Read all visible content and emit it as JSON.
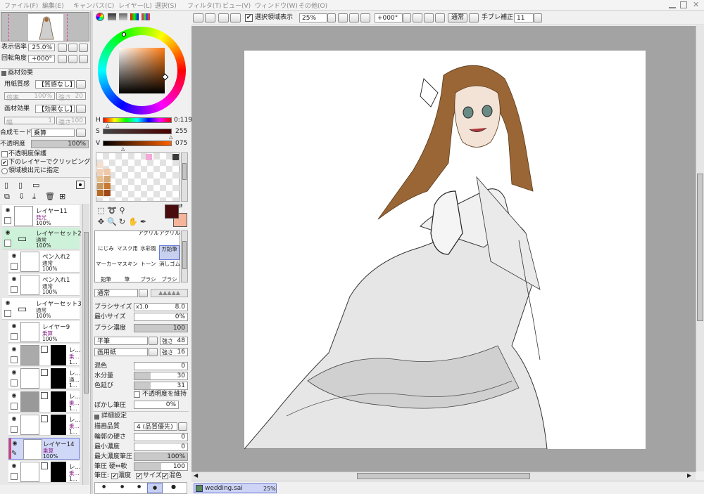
{
  "menu": [
    "ファイル(F)",
    "編集(E)",
    "キャンバス(C)",
    "レイヤー(L)",
    "選択(S)",
    "フィルタ(T)",
    "ビュー(V)",
    "ウィンドウ(W)",
    "その他(O)"
  ],
  "navigator": {
    "zoom_label": "表示倍率",
    "zoom_value": "25.0%",
    "rotate_label": "回転角度",
    "rotate_value": "+000°"
  },
  "texture": {
    "section": "画材効果",
    "paper_label": "用紙質感",
    "paper_value": "【質感なし】",
    "scale_label": "倍率",
    "scale_value": "100%",
    "strength_label": "強さ",
    "strength_value": "20",
    "effect_label": "画材効果",
    "effect_value": "【効果なし】",
    "width_label": "幅",
    "width_value": "1",
    "strength2_label": "強さ",
    "strength2_value": "100"
  },
  "blend": {
    "mode_label": "合成モード",
    "mode_value": "乗算",
    "opacity_label": "不透明度",
    "opacity_value": "100%",
    "opacity_fraction": 1.0,
    "protect": "不透明度保護",
    "clipping": "下のレイヤーでクリッピング",
    "selection_source": "領域検出元に指定"
  },
  "layers": [
    {
      "name": "レイヤー11",
      "mode": "発光",
      "opacity": "100%"
    },
    {
      "name": "レイヤーセット2",
      "mode": "通常",
      "opacity": "100%"
    },
    {
      "name": "ペン入れ2",
      "mode": "通常",
      "opacity": "100%"
    },
    {
      "name": "ペン入れ1",
      "mode": "通常",
      "opacity": "100%"
    },
    {
      "name": "レイヤーセット3",
      "mode": "通常",
      "opacity": "100%"
    },
    {
      "name": "レイヤー9",
      "mode": "乗算",
      "opacity": "100%"
    },
    {
      "name": "レ...",
      "mode": "乗...",
      "opacity": "1..."
    },
    {
      "name": "レ...",
      "mode": "通...",
      "opacity": "1..."
    },
    {
      "name": "レ...",
      "mode": "乗...",
      "opacity": "1..."
    },
    {
      "name": "レ...",
      "mode": "乗...",
      "opacity": "1..."
    },
    {
      "name": "レイヤー14",
      "mode": "乗算",
      "opacity": "100%"
    },
    {
      "name": "レ...",
      "mode": "乗...",
      "opacity": "1..."
    }
  ],
  "color": {
    "h_label": "H",
    "h_value": "0:119",
    "s_label": "S",
    "s_value": "255",
    "v_label": "V",
    "v_value": "075",
    "main": "#4a0d0d",
    "sub": "#f6b59a"
  },
  "swatches": [
    "#f3a8d8",
    "#3a3a3a",
    "#f4e0d0",
    "#f2d0b8",
    "#f0c8a8",
    "#e8c090",
    "#d8a878",
    "#c89860",
    "#c87a30",
    "#b86a20",
    "#a04818"
  ],
  "brushes": [
    {
      "a": "",
      "b": "",
      "c": "アクリル",
      "d": "アクリル"
    },
    {
      "a": "にじみ",
      "b": "マスク用にじみ",
      "c": "水彩風",
      "d": "ガ鉛筆"
    },
    {
      "a": "マーカー",
      "b": "マスキング",
      "c": "トーン",
      "d": "消しゴム"
    },
    {
      "a": "鉛筆",
      "b": "筆",
      "c": "ブラシ",
      "d": "ブラシ"
    }
  ],
  "brush_settings": {
    "blend_value": "通常",
    "size_label": "ブラシサイズ",
    "size_mult": "x1.0",
    "size_value": "8.0",
    "min_size_label": "最小サイズ",
    "min_size_value": "0%",
    "density_label": "ブラシ濃度",
    "density_value": "100",
    "shape_value": "平筆",
    "shape_str_label": "強さ",
    "shape_str_value": "48",
    "tex_value": "画用紙",
    "tex_str_label": "強さ",
    "tex_str_value": "16",
    "mix_label": "混色",
    "mix_value": "0",
    "water_label": "水分量",
    "water_value": "30",
    "stretch_label": "色延び",
    "stretch_value": "31",
    "keep_opacity": "不透明度を維持",
    "blur_label": "ぼかし筆圧",
    "blur_value": "0%",
    "advanced": "詳細設定",
    "quality_label": "描画品質",
    "quality_value": "4 (品質優先)",
    "edge_label": "輪郭の硬さ",
    "edge_value": "0",
    "min_density_label": "最小濃度",
    "min_density_value": "0",
    "max_pressure_label": "最大濃度筆圧",
    "max_pressure_value": "100%",
    "pressure_label": "筆圧 硬⇔軟",
    "pressure_value": "100",
    "pressure_opts": "筆圧:",
    "opt_density": "濃度",
    "opt_size": "サイズ",
    "opt_mix": "混色"
  },
  "toolbar": {
    "show_selection": "選択領域表示",
    "zoom": "25%",
    "rotate": "+000°",
    "mode": "通常",
    "stabilizer_label": "手ブレ補正",
    "stabilizer_value": "11"
  },
  "document": {
    "tab": "wedding.sai",
    "zoom": "25%"
  }
}
